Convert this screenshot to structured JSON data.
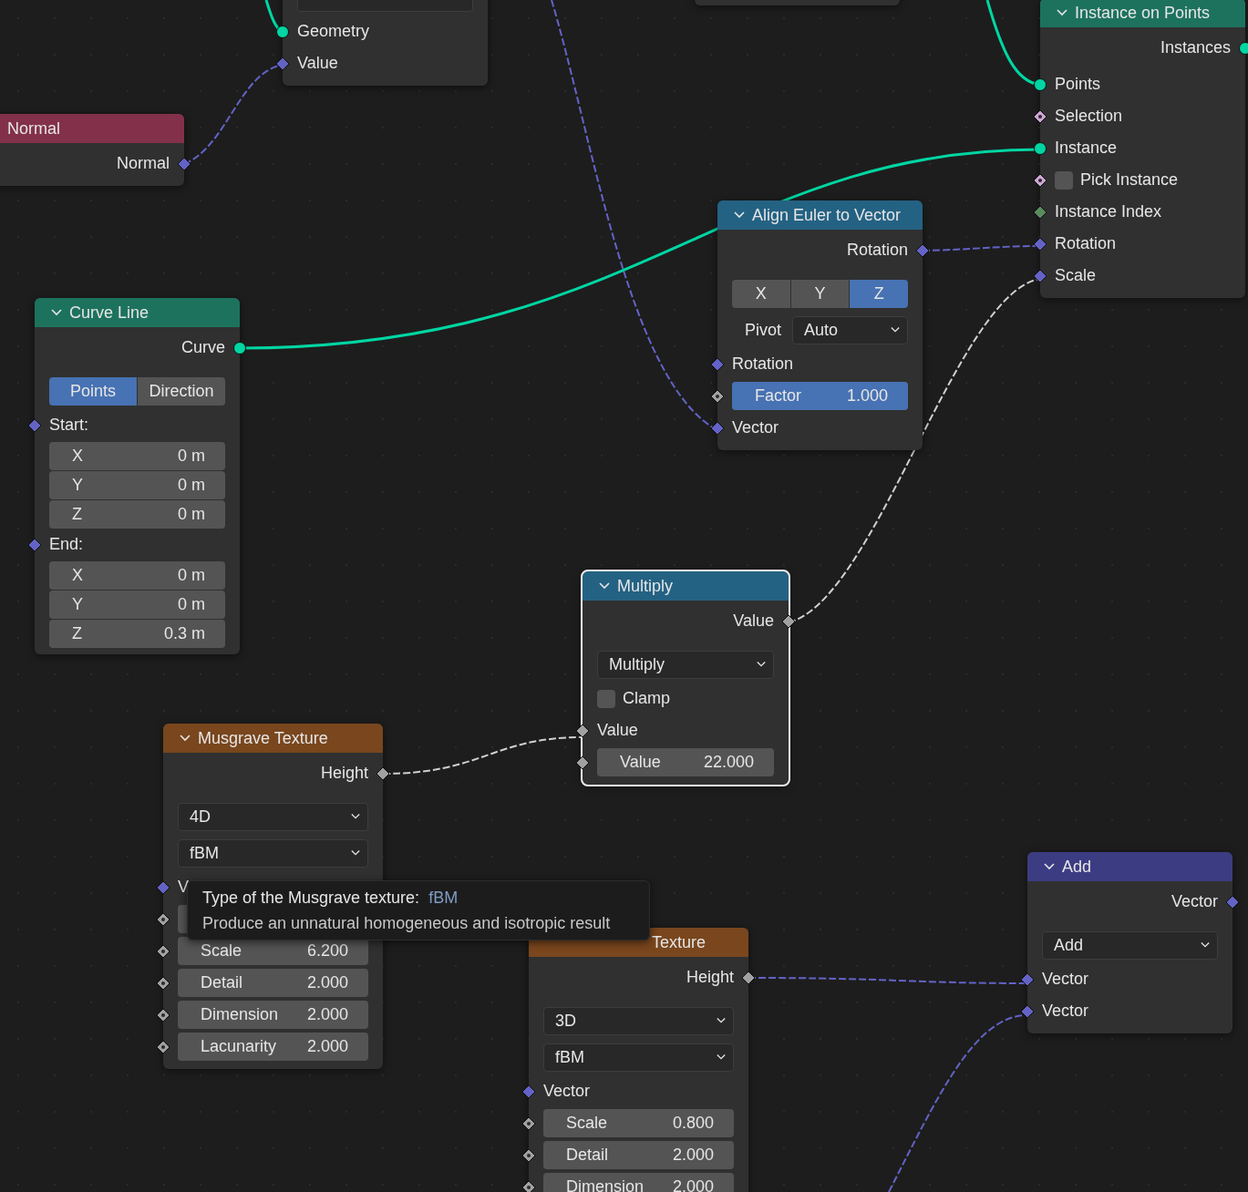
{
  "nodes": [
    {
      "selected": false,
      "rows": [
        {
          "kind": "dropdown"
        },
        {
          "kind": "input",
          "label": "Geometry",
          "socket": {
            "kind": "geometry"
          }
        },
        {
          "kind": "input",
          "label": "Value",
          "socket": {
            "kind": "vector"
          }
        }
      ]
    },
    {
      "selected": false
    },
    {
      "title": "Normal",
      "color": "#83314a",
      "selected": false,
      "rows": [
        {
          "kind": "output",
          "label": "Normal",
          "socket": {
            "kind": "vector"
          }
        }
      ]
    },
    {
      "title": "Instance on Points",
      "color": "#1d725e",
      "selected": false,
      "rows": [
        {
          "kind": "output",
          "label": "Instances",
          "socket": {
            "kind": "geometry"
          }
        },
        {
          "kind": "input",
          "label": "Points",
          "socket": {
            "kind": "geometry"
          }
        },
        {
          "kind": "input",
          "label": "Selection",
          "socket": {
            "kind": "bool_field"
          }
        },
        {
          "kind": "input",
          "label": "Instance",
          "socket": {
            "kind": "geometry"
          }
        },
        {
          "kind": "checkbox",
          "label": "Pick Instance",
          "checked": false,
          "socket": {
            "kind": "bool_field"
          }
        },
        {
          "kind": "input",
          "label": "Instance Index",
          "socket": {
            "kind": "int"
          }
        },
        {
          "kind": "input",
          "label": "Rotation",
          "socket": {
            "kind": "vector"
          }
        },
        {
          "kind": "input",
          "label": "Scale",
          "socket": {
            "kind": "vector"
          }
        }
      ]
    },
    {
      "title": "Align Euler to Vector",
      "color": "#246283",
      "selected": false,
      "rows": [
        {
          "kind": "output",
          "label": "Rotation",
          "socket": {
            "kind": "vector"
          }
        },
        {
          "kind": "segmented",
          "options": [
            {
              "label": "X",
              "selected": false
            },
            {
              "label": "Y",
              "selected": false
            },
            {
              "label": "Z",
              "selected": true
            }
          ]
        },
        {
          "kind": "dropdown",
          "label": "Pivot",
          "value": "Auto"
        },
        {
          "kind": "input",
          "label": "Rotation",
          "socket": {
            "kind": "vector"
          }
        },
        {
          "kind": "field",
          "label": "Factor",
          "value": "1.000",
          "level": 1,
          "socket": {
            "kind": "float_field"
          }
        },
        {
          "kind": "input",
          "label": "Vector",
          "socket": {
            "kind": "vector"
          }
        }
      ]
    },
    {
      "title": "Curve Line",
      "color": "#1d725e",
      "selected": false,
      "rows": [
        {
          "kind": "output",
          "label": "Curve",
          "socket": {
            "kind": "geometry"
          }
        },
        {
          "kind": "segmented",
          "options": [
            {
              "label": "Points",
              "selected": true
            },
            {
              "label": "Direction",
              "selected": false
            }
          ]
        },
        {
          "kind": "input",
          "label": "Start:",
          "socket": {
            "kind": "vector"
          }
        },
        {
          "kind": "field",
          "label": "X",
          "value": "0 m"
        },
        {
          "kind": "field",
          "label": "Y",
          "value": "0 m"
        },
        {
          "kind": "field",
          "label": "Z",
          "value": "0 m"
        },
        {
          "kind": "input",
          "label": "End:",
          "socket": {
            "kind": "vector"
          }
        },
        {
          "kind": "field",
          "label": "X",
          "value": "0 m"
        },
        {
          "kind": "field",
          "label": "Y",
          "value": "0 m"
        },
        {
          "kind": "field",
          "label": "Z",
          "value": "0.3 m"
        }
      ]
    },
    {
      "title": "Multiply",
      "color": "#246283",
      "selected": true,
      "rows": [
        {
          "kind": "output",
          "label": "Value",
          "socket": {
            "kind": "float"
          }
        },
        {
          "kind": "dropdown",
          "value": "Multiply"
        },
        {
          "kind": "checkbox",
          "label": "Clamp",
          "checked": false
        },
        {
          "kind": "input",
          "label": "Value",
          "socket": {
            "kind": "float"
          }
        },
        {
          "kind": "field",
          "label": "Value",
          "value": "22.000",
          "socket": {
            "kind": "float"
          }
        }
      ]
    },
    {
      "title": "Musgrave Texture",
      "color": "#79461d",
      "selected": false,
      "rows": [
        {
          "kind": "output",
          "label": "Height",
          "socket": {
            "kind": "float"
          }
        },
        {
          "kind": "dropdown",
          "value": "4D"
        },
        {
          "kind": "dropdown",
          "value": "fBM"
        },
        {
          "kind": "input",
          "label": "V",
          "socket": {
            "kind": "vector"
          }
        },
        {
          "kind": "field",
          "socket": {
            "kind": "float_field"
          }
        },
        {
          "kind": "field",
          "label": "Scale",
          "value": "6.200",
          "socket": {
            "kind": "float_field"
          }
        },
        {
          "kind": "field",
          "label": "Detail",
          "value": "2.000",
          "socket": {
            "kind": "float_field"
          }
        },
        {
          "kind": "field",
          "label": "Dimension",
          "value": "2.000",
          "socket": {
            "kind": "float_field"
          }
        },
        {
          "kind": "field",
          "label": "Lacunarity",
          "value": "2.000",
          "socket": {
            "kind": "float_field"
          }
        }
      ]
    },
    {
      "title": "Texture",
      "color": "#79461d",
      "selected": false,
      "rows": [
        {
          "kind": "output",
          "label": "Height",
          "socket": {
            "kind": "float"
          }
        },
        {
          "kind": "dropdown",
          "value": "3D"
        },
        {
          "kind": "dropdown",
          "value": "fBM"
        },
        {
          "kind": "input",
          "label": "Vector",
          "socket": {
            "kind": "vector"
          }
        },
        {
          "kind": "field",
          "label": "Scale",
          "value": "0.800",
          "socket": {
            "kind": "float_field"
          }
        },
        {
          "kind": "field",
          "label": "Detail",
          "value": "2.000",
          "socket": {
            "kind": "float_field"
          }
        },
        {
          "kind": "field",
          "label": "Dimension",
          "value": "2.000",
          "socket": {
            "kind": "float_field"
          }
        }
      ]
    },
    {
      "title": "Add",
      "color": "#3c3c83",
      "selected": false,
      "rows": [
        {
          "kind": "output",
          "label": "Vector",
          "socket": {
            "kind": "vector"
          }
        },
        {
          "kind": "dropdown",
          "value": "Add"
        },
        {
          "kind": "input",
          "label": "Vector",
          "socket": {
            "kind": "vector"
          }
        },
        {
          "kind": "input",
          "label": "Vector",
          "socket": {
            "kind": "vector"
          }
        }
      ]
    }
  ],
  "tooltip": {
    "title": "Type of the Musgrave texture:",
    "value": "fBM",
    "description": "Produce an unnatural homogeneous and isotropic result"
  }
}
